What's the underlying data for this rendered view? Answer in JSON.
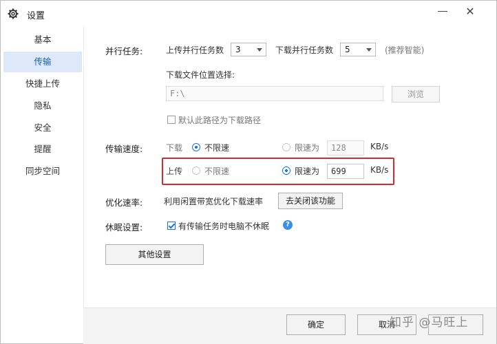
{
  "window": {
    "title": "设置",
    "close_glyph": "✕"
  },
  "sidebar": {
    "items": [
      {
        "label": "基本"
      },
      {
        "label": "传输",
        "active": true
      },
      {
        "label": "快捷上传"
      },
      {
        "label": "隐私"
      },
      {
        "label": "安全"
      },
      {
        "label": "提醒"
      },
      {
        "label": "同步空间"
      }
    ]
  },
  "parallel": {
    "label": "并行任务:",
    "upload_label": "上传并行任务数",
    "upload_value": "3",
    "download_label": "下载并行任务数",
    "download_value": "5",
    "hint": "(推荐智能)"
  },
  "download_location": {
    "label": "下载文件位置选择:",
    "path": "F:\\",
    "browse_label": "浏览",
    "default_checkbox_label": "默认此路径为下载路径",
    "default_checked": false
  },
  "speed": {
    "label": "传输速度:",
    "download": {
      "label": "下载",
      "unlimited_label": "不限速",
      "limit_label": "限速为",
      "limit_value": "128",
      "unit": "KB/s",
      "selected": "unlimited"
    },
    "upload": {
      "label": "上传",
      "unlimited_label": "不限速",
      "limit_label": "限速为",
      "limit_value": "699",
      "unit": "KB/s",
      "selected": "limit"
    }
  },
  "optimize": {
    "label": "优化速率:",
    "text": "利用闲置带宽优化下载速率",
    "button_label": "去关闭该功能"
  },
  "sleep": {
    "label": "休眠设置:",
    "checkbox_label": "有传输任务时电脑不休眠",
    "checked": true,
    "help_glyph": "?"
  },
  "other_settings_label": "其他设置",
  "footer": {
    "ok_label": "确定",
    "cancel_label": "取消"
  },
  "watermark": "知乎 @马旺上",
  "colors": {
    "accent": "#1e73d8",
    "highlight": "#d9272e",
    "sidebar_active": "#dde9f8"
  },
  "icons": {
    "title": "gear-icon",
    "help": "help-icon"
  }
}
